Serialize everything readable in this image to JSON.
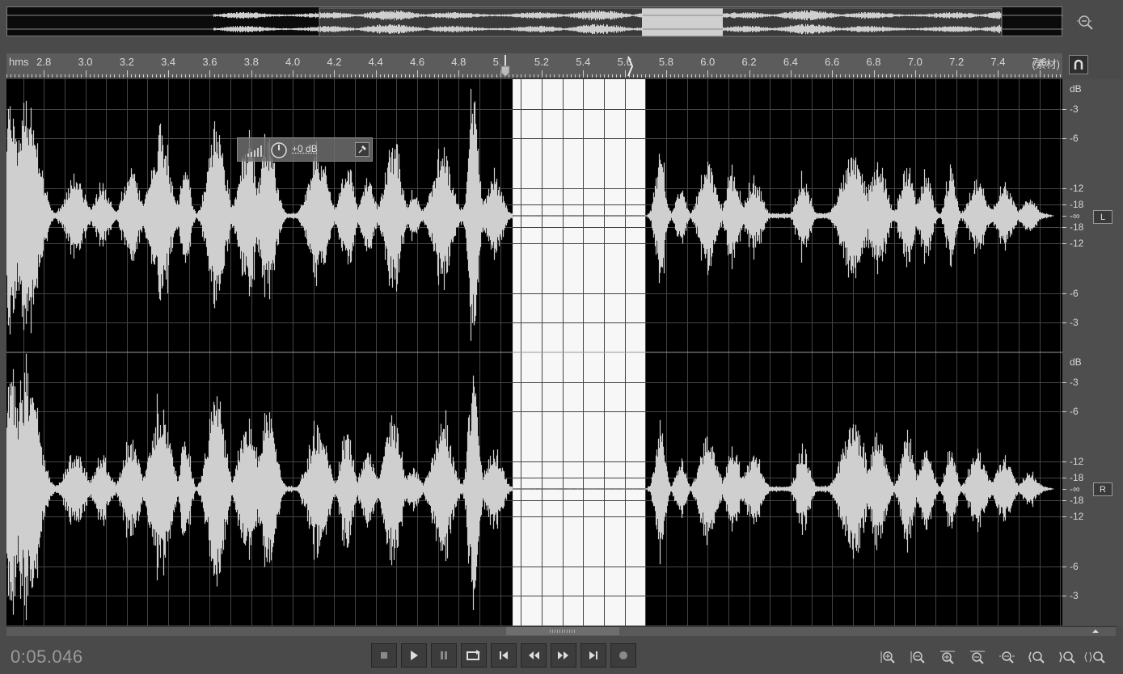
{
  "ruler": {
    "unit": "hms",
    "timebase": "(素材)",
    "labels": [
      "2.8",
      "3.0",
      "3.2",
      "3.4",
      "3.6",
      "3.8",
      "4.0",
      "4.2",
      "4.4",
      "4.6",
      "4.8",
      "5.0",
      "5.2",
      "5.4",
      "5.6",
      "5.8",
      "6.0",
      "6.2",
      "6.4",
      "6.6",
      "6.8",
      "7.0",
      "7.2",
      "7.4",
      "7.6"
    ],
    "start_seconds": 2.62,
    "end_seconds": 7.71
  },
  "selection": {
    "start_seconds": 5.06,
    "end_seconds": 5.7
  },
  "hud": {
    "gain": "+0 dB"
  },
  "db_scale": {
    "unit": "dB",
    "labels": [
      "-3",
      "-6",
      "-12",
      "-18",
      "-∞",
      "-18",
      "-12",
      "-6",
      "-3"
    ],
    "left_channel": "L",
    "right_channel": "R"
  },
  "status": {
    "current_time": "0:05.046"
  },
  "transport": {
    "buttons": [
      {
        "name": "stop-button",
        "icon": "stop-icon"
      },
      {
        "name": "play-button",
        "icon": "play-icon"
      },
      {
        "name": "pause-button",
        "icon": "pause-icon"
      },
      {
        "name": "loop-button",
        "icon": "loop-icon"
      },
      {
        "name": "go-to-start-button",
        "icon": "skip-back-icon"
      },
      {
        "name": "rewind-button",
        "icon": "rewind-icon"
      },
      {
        "name": "fast-forward-button",
        "icon": "fast-forward-icon"
      },
      {
        "name": "go-to-end-button",
        "icon": "skip-forward-icon"
      },
      {
        "name": "record-button",
        "icon": "record-icon"
      }
    ]
  },
  "zoom_buttons": [
    "zoom-in-amplitude-icon",
    "zoom-out-amplitude-icon",
    "zoom-in-time-icon",
    "zoom-out-time-icon",
    "zoom-full-icon",
    "zoom-in-left-icon",
    "zoom-in-right-icon",
    "zoom-selection-icon"
  ],
  "colors": {
    "waveform": "#cfcfcf",
    "background": "#000000",
    "selection": "#f7f7f7",
    "panel": "#4a4a4a"
  }
}
